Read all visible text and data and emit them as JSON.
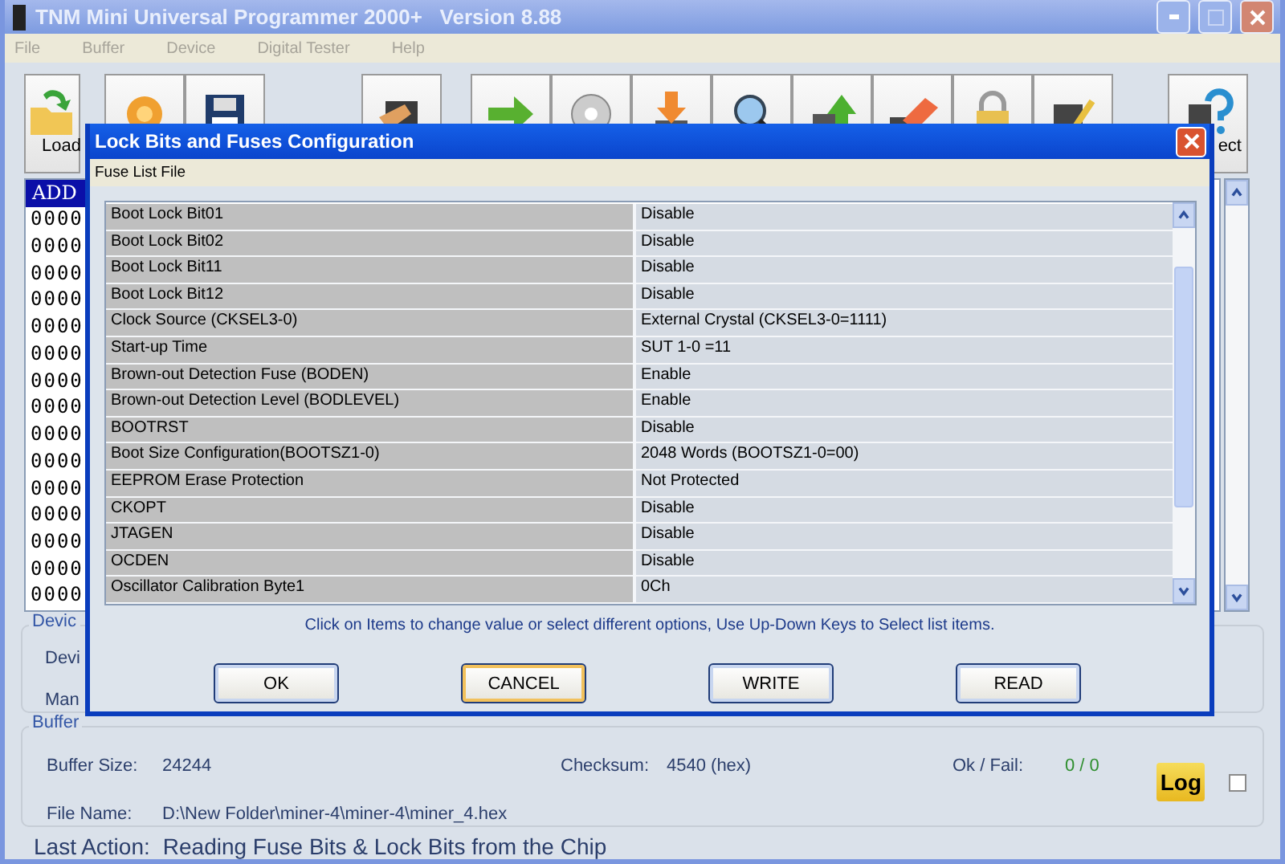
{
  "window": {
    "title": "TNM Mini Universal Programmer 2000+   Version 8.88"
  },
  "menu": [
    "File",
    "Buffer",
    "Device",
    "Digital Tester",
    "Help"
  ],
  "toolbar": {
    "load_label": "Load",
    "detect_label": "ect"
  },
  "hex": {
    "header": "ADD",
    "rows": [
      "0000",
      "0000",
      "0000",
      "0000",
      "0000",
      "0000",
      "0000",
      "0000",
      "0000",
      "0000",
      "0000",
      "0000",
      "0000",
      "0000",
      "0000"
    ]
  },
  "device_info": {
    "title": "Devic",
    "labels": [
      "Devi",
      "Man"
    ]
  },
  "buffer_info": {
    "title": "Buffer",
    "size_label": "Buffer Size:",
    "size": "24244",
    "checksum_label": "Checksum:",
    "checksum": "4540 (hex)",
    "okfail_label": "Ok / Fail:",
    "okfail": "0 / 0",
    "file_label": "File Name:",
    "file": "D:\\New Folder\\miner-4\\miner-4\\miner_4.hex",
    "log": "Log",
    "log_checked": false
  },
  "last_action": {
    "label": "Last Action:",
    "value": "Reading Fuse Bits & Lock Bits from the Chip"
  },
  "dialog": {
    "title": "Lock Bits and Fuses Configuration",
    "menu": [
      "Fuse List File"
    ],
    "rows": [
      {
        "label": "Boot Lock Bit01",
        "value": "Disable"
      },
      {
        "label": "Boot Lock Bit02",
        "value": "Disable"
      },
      {
        "label": "Boot Lock Bit11",
        "value": "Disable"
      },
      {
        "label": "Boot Lock Bit12",
        "value": "Disable"
      },
      {
        "label": "Clock Source (CKSEL3-0)",
        "value": "External Crystal (CKSEL3-0=1111)"
      },
      {
        "label": "Start-up Time",
        "value": "SUT 1-0 =11"
      },
      {
        "label": "Brown-out Detection Fuse (BODEN)",
        "value": "Enable"
      },
      {
        "label": "Brown-out Detection Level (BODLEVEL)",
        "value": "Enable"
      },
      {
        "label": "BOOTRST",
        "value": "Disable"
      },
      {
        "label": "Boot Size Configuration(BOOTSZ1-0)",
        "value": "2048 Words (BOOTSZ1-0=00)"
      },
      {
        "label": "EEPROM Erase Protection",
        "value": "Not Protected"
      },
      {
        "label": "CKOPT",
        "value": "Disable"
      },
      {
        "label": "JTAGEN",
        "value": "Disable"
      },
      {
        "label": "OCDEN",
        "value": "Disable"
      },
      {
        "label": "Oscillator Calibration Byte1",
        "value": "0Ch"
      }
    ],
    "hint": "Click on Items to change value or select different options, Use Up-Down Keys to Select list items.",
    "buttons": [
      {
        "label": "OK",
        "focused": false
      },
      {
        "label": "CANCEL",
        "focused": true
      },
      {
        "label": "WRITE",
        "focused": false
      },
      {
        "label": "READ",
        "focused": false
      }
    ]
  }
}
